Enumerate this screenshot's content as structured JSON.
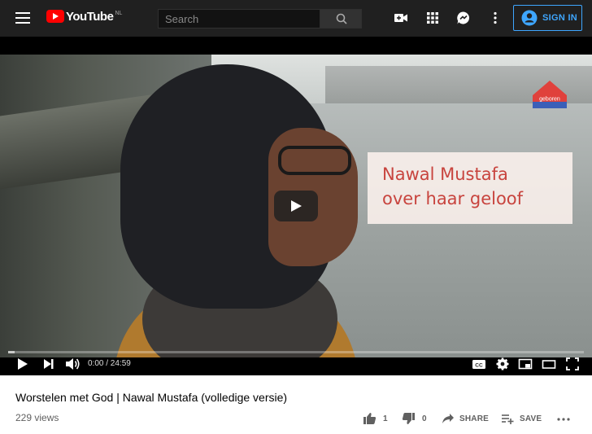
{
  "header": {
    "logo_text": "YouTube",
    "country": "NL",
    "search_placeholder": "Search",
    "signin_label": "SIGN IN",
    "accent": "#3ea6ff",
    "brand_color": "#ff0000"
  },
  "video": {
    "overlay_title_line1": "Nawal Mustafa",
    "overlay_title_line2": "over haar geloof",
    "brand_logo_text": "geboren",
    "time_display": "0:00 / 24:59",
    "progress": 0
  },
  "info": {
    "title": "Worstelen met God | Nawal Mustafa (volledige versie)",
    "views": "229 views",
    "likes": "1",
    "dislikes": "0",
    "share_label": "SHARE",
    "save_label": "SAVE"
  },
  "icons": {
    "menu": "hamburger-menu-icon",
    "search": "search-icon",
    "create": "video-camera-icon",
    "apps": "apps-grid-icon",
    "messages": "messages-icon",
    "more": "more-vertical-icon",
    "account": "account-circle-icon"
  }
}
